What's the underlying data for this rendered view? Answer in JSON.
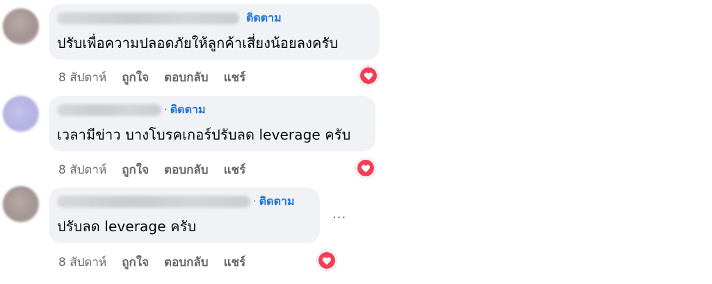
{
  "colors": {
    "bubble_bg": "#f0f2f5",
    "follow_link": "#1b74e4",
    "meta_text": "#65676b",
    "reaction_love": "#f33e58"
  },
  "comments": [
    {
      "follow_label": "ติดตาม",
      "text": "ปรับเพื่อความปลอดภัยให้ลูกค้าเสี่ยงน้อยลงครับ",
      "time": "8 สัปดาห์",
      "like_label": "ถูกใจ",
      "reply_label": "ตอบกลับ",
      "share_label": "แชร์",
      "reaction_icon": "love-reaction-icon"
    },
    {
      "follow_label": "ติดตาม",
      "text": "เวลามีข่าว บางโบรคเกอร์ปรับลด leverage ครับ",
      "time": "8 สัปดาห์",
      "like_label": "ถูกใจ",
      "reply_label": "ตอบกลับ",
      "share_label": "แชร์",
      "reaction_icon": "love-reaction-icon"
    },
    {
      "follow_label": "ติดตาม",
      "text": "ปรับลด leverage ครับ",
      "time": "8 สัปดาห์",
      "like_label": "ถูกใจ",
      "reply_label": "ตอบกลับ",
      "share_label": "แชร์",
      "reaction_icon": "love-reaction-icon",
      "more_label": "..."
    }
  ]
}
